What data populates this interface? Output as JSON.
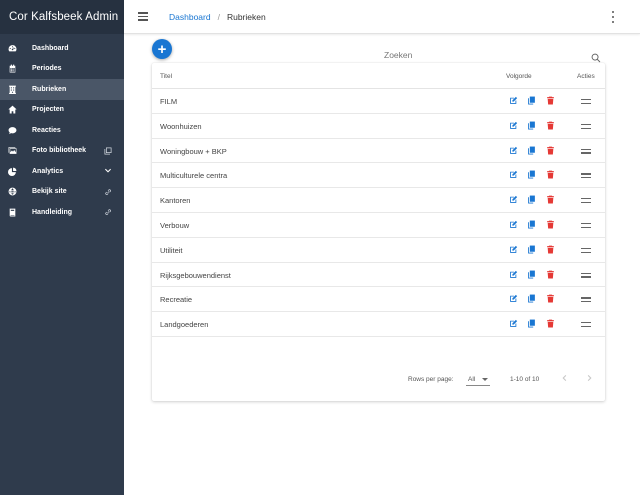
{
  "app": {
    "title": "Cor Kalfsbeek Admin"
  },
  "sidebar": {
    "items": [
      {
        "label": "Dashboard",
        "icon": "dashboard-icon",
        "active": false
      },
      {
        "label": "Periodes",
        "icon": "calendar-icon",
        "active": false
      },
      {
        "label": "Rubrieken",
        "icon": "building-icon",
        "active": true
      },
      {
        "label": "Projecten",
        "icon": "home-icon",
        "active": false
      },
      {
        "label": "Reacties",
        "icon": "comment-icon",
        "active": false
      },
      {
        "label": "Foto bibliotheek",
        "icon": "images-icon",
        "active": false,
        "trailing": "external-window-icon"
      },
      {
        "label": "Analytics",
        "icon": "pie-chart-icon",
        "active": false,
        "trailing": "chevron-down-icon"
      },
      {
        "label": "Bekijk site",
        "icon": "globe-icon",
        "active": false,
        "trailing": "link-icon"
      },
      {
        "label": "Handleiding",
        "icon": "book-icon",
        "active": false,
        "trailing": "link-icon"
      }
    ]
  },
  "header": {
    "breadcrumb": {
      "link": "Dashboard",
      "separator": "/",
      "current": "Rubrieken"
    }
  },
  "search": {
    "placeholder": "Zoeken"
  },
  "table": {
    "columns": {
      "title": "Titel",
      "order": "Volgorde",
      "actions": "Acties"
    },
    "rows": [
      {
        "title": "FILM"
      },
      {
        "title": "Woonhuizen"
      },
      {
        "title": "Woningbouw + BKP"
      },
      {
        "title": "Multiculturele centra"
      },
      {
        "title": "Kantoren"
      },
      {
        "title": "Verbouw"
      },
      {
        "title": "Utiliteit"
      },
      {
        "title": "Rijksgebouwendienst"
      },
      {
        "title": "Recreatie"
      },
      {
        "title": "Landgoederen"
      }
    ],
    "footer": {
      "rows_per_page_label": "Rows per page:",
      "rows_per_page_value": "All",
      "range": "1-10 of 10"
    }
  },
  "colors": {
    "sidebar_bg": "#2f3b4c",
    "sidebar_header_bg": "#263140",
    "sidebar_active_bg": "#4a5667",
    "primary": "#1976d2",
    "delete": "#e53935"
  }
}
